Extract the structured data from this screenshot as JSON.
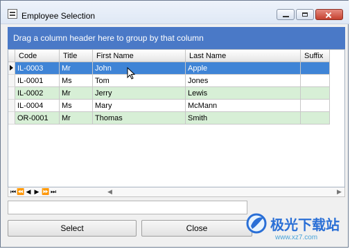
{
  "window": {
    "title": "Employee Selection"
  },
  "group_panel": {
    "hint": "Drag a column header here to group by that column"
  },
  "table": {
    "columns": [
      "Code",
      "Title",
      "First Name",
      "Last Name",
      "Suffix"
    ],
    "rows": [
      {
        "code": "IL-0003",
        "title": "Mr",
        "first": "John",
        "last": "Apple",
        "suffix": ""
      },
      {
        "code": "IL-0001",
        "title": "Ms",
        "first": "Tom",
        "last": "Jones",
        "suffix": ""
      },
      {
        "code": "IL-0002",
        "title": "Mr",
        "first": "Jerry",
        "last": "Lewis",
        "suffix": ""
      },
      {
        "code": "IL-0004",
        "title": "Ms",
        "first": "Mary",
        "last": "McMann",
        "suffix": ""
      },
      {
        "code": "OR-0001",
        "title": "Mr",
        "first": "Thomas",
        "last": "Smith",
        "suffix": ""
      }
    ]
  },
  "buttons": {
    "select": "Select",
    "close": "Close"
  },
  "icons": {
    "app": "form-icon",
    "minimize": "minimize-icon",
    "maximize": "maximize-icon",
    "close": "close-icon",
    "first": "first-record-icon",
    "previous_page": "previous-page-icon",
    "previous": "previous-record-icon",
    "next": "next-record-icon",
    "next_page": "next-page-icon",
    "last": "last-record-icon",
    "cursor": "mouse-cursor-icon"
  },
  "watermark": {
    "text": "极光下载站",
    "url": "www.xz7.com"
  },
  "colors": {
    "selected_row": "#3f84d6",
    "alternate_row": "#d7efd6",
    "group_panel": "#4a79c7"
  }
}
